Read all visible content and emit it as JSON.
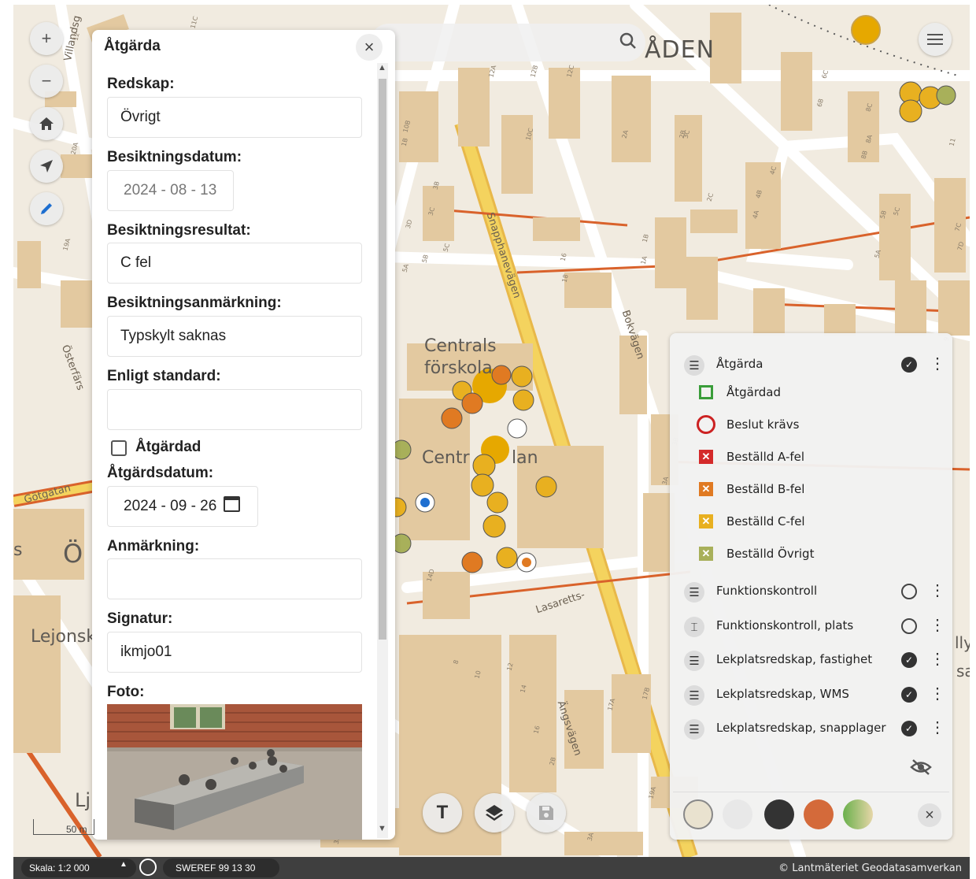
{
  "map": {
    "place_labels": {
      "area": "ÅDEN",
      "preschool": "Centrals\nförskola",
      "centr": "Centr",
      "lan": "lan",
      "os": "Ö",
      "lejons": "Lejonsk",
      "lj": "Lj",
      "s": "s",
      "ly": "lly",
      "sal": "sal"
    },
    "roads": {
      "villandsg": "Villandsg",
      "osterfars": "Österfärs",
      "gotgatan": "Götgatan",
      "snapphane": "Snapphanevägen",
      "bokvagen": "Bokvägen",
      "lasaretts": "Lasaretts-",
      "angsvagen": "Ängsvägen"
    },
    "house_numbers": [
      "11C",
      "20A",
      "19A",
      "12",
      "10B",
      "10C",
      "1B",
      "3B",
      "3C",
      "3D",
      "5B",
      "5C",
      "5A",
      "12A",
      "12B",
      "12C",
      "18",
      "16",
      "4A",
      "4B",
      "4C",
      "2A",
      "2B",
      "2C",
      "1A",
      "1B",
      "6B",
      "6C",
      "8A",
      "8B",
      "8C",
      "5A",
      "5B",
      "5C",
      "7C",
      "7D",
      "9",
      "11",
      "14D",
      "17A",
      "17B",
      "19A",
      "3A",
      "3B",
      "3C",
      "8",
      "10",
      "12",
      "14",
      "16",
      "2B",
      "3A",
      "3B"
    ],
    "search_icon": "search-icon"
  },
  "controls": {
    "zoom_in": "+",
    "zoom_out": "−",
    "home_icon": "home-icon",
    "locate_icon": "navigation-arrow-icon",
    "edit_icon": "pencil-icon",
    "menu_icon": "hamburger-menu-icon"
  },
  "panel": {
    "title": "Åtgärda",
    "close": "×",
    "fields": {
      "redskap_label": "Redskap:",
      "redskap_value": "Övrigt",
      "besiktningsdatum_label": "Besiktningsdatum:",
      "besiktningsdatum_value": "2024 - 08 - 13",
      "besiktningsresultat_label": "Besiktningsresultat:",
      "besiktningsresultat_value": "C fel",
      "besiktningsanmarkning_label": "Besiktningsanmärkning:",
      "besiktningsanmarkning_value": "Typskylt saknas",
      "enligt_standard_label": "Enligt standard:",
      "enligt_standard_value": "",
      "atgardad_label": "Åtgärdad",
      "atgardsdatum_label": "Åtgärdsdatum:",
      "atgardsdatum_value": "2024 - 09 - 26",
      "anmarkning_label": "Anmärkning:",
      "anmarkning_value": "",
      "signatur_label": "Signatur:",
      "signatur_value": "ikmjo01",
      "foto_label": "Foto:"
    },
    "atgardad_checked": false
  },
  "toolbar": {
    "text_tool": "T",
    "layers_icon": "layers-icon",
    "save_icon": "save-icon"
  },
  "legend": {
    "groups": [
      {
        "label": "Åtgärda",
        "visible": true
      },
      {
        "label": "Funktionskontroll",
        "visible": false
      },
      {
        "label": "Funktionskontroll, plats",
        "visible": false
      },
      {
        "label": "Lekplatsredskap, fastighet",
        "visible": true
      },
      {
        "label": "Lekplatsredskap, WMS",
        "visible": true
      },
      {
        "label": "Lekplatsredskap, snapplager",
        "visible": true
      }
    ],
    "atgarda_items": [
      {
        "label": "Åtgärdad",
        "symbol": "green-square",
        "color": "#3a9d3a"
      },
      {
        "label": "Beslut krävs",
        "symbol": "red-circle",
        "color": "#cc2222"
      },
      {
        "label": "Beställd A-fel",
        "symbol": "red-x-square",
        "color": "#d42a2a"
      },
      {
        "label": "Beställd B-fel",
        "symbol": "orange-x-square",
        "color": "#e07a22"
      },
      {
        "label": "Beställd C-fel",
        "symbol": "yellow-x-square",
        "color": "#e8b020"
      },
      {
        "label": "Beställd Övrigt",
        "symbol": "olive-x-square",
        "color": "#a8b05a"
      }
    ],
    "hide_icon": "eye-off-icon",
    "close": "×"
  },
  "status_bar": {
    "scale": "Skala: 1:2 000",
    "crs": "SWEREF 99 13 30",
    "attribution": "© Lantmäteriet Geodatasamverkan",
    "scale_bar_label": "50 m"
  },
  "colors": {
    "map_background": "#f1ebe0",
    "building": "#e3c9a0",
    "major_road": "#f4d35e",
    "road_edge": "#d9622b"
  }
}
